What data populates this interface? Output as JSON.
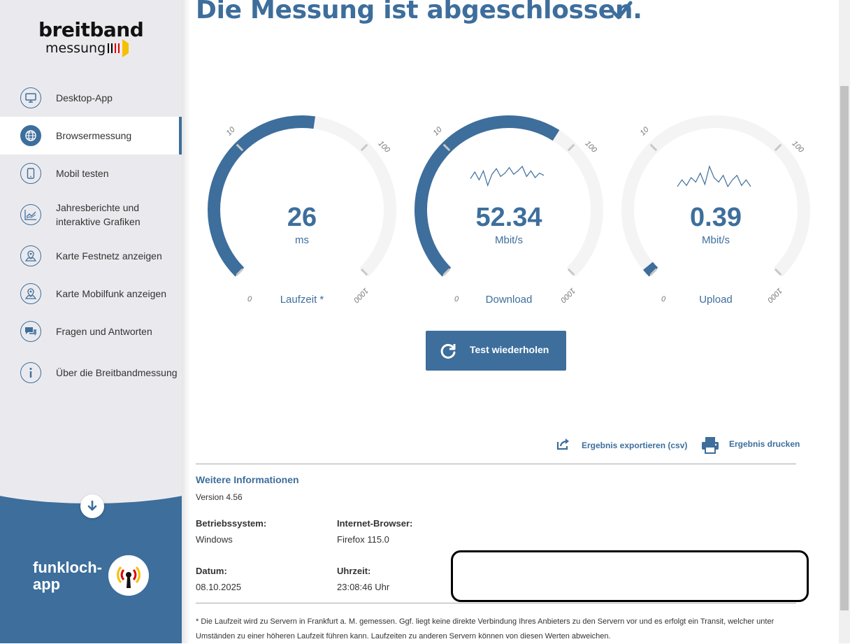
{
  "brand": {
    "line1": "breitband",
    "line2": "messung",
    "flag_colors": [
      "#000000",
      "#dd0000",
      "#ffce00"
    ]
  },
  "sidebar": {
    "items": [
      {
        "label": "Desktop-App",
        "icon": "monitor-icon",
        "active": false
      },
      {
        "label": "Browsermessung",
        "icon": "globe-icon",
        "active": true
      },
      {
        "label": "Mobil testen",
        "icon": "phone-icon",
        "active": false
      },
      {
        "label": "Jahresberichte und interaktive Grafiken",
        "icon": "chart-icon",
        "active": false
      },
      {
        "label": "Karte Festnetz anzeigen",
        "icon": "map-pin-icon",
        "active": false
      },
      {
        "label": "Karte Mobilfunk anzeigen",
        "icon": "map-pin-icon",
        "active": false
      },
      {
        "label": "Fragen und Antworten",
        "icon": "chat-icon",
        "active": false
      },
      {
        "label": "Über die Breitbandmessung",
        "icon": "info-icon",
        "active": false
      }
    ],
    "funkloch_line1": "funkloch-",
    "funkloch_line2": "app"
  },
  "headline": "Die Messung ist abgeschlossen.",
  "gauges": [
    {
      "id": "laufzeit",
      "value": "26",
      "unit": "ms",
      "label": "Laufzeit *",
      "scale": [
        "0",
        "10",
        "100",
        "1000"
      ],
      "fill_fraction": 0.53,
      "sparkline": false
    },
    {
      "id": "download",
      "value": "52.34",
      "unit": "Mbit/s",
      "label": "Download",
      "scale": [
        "0",
        "10",
        "100",
        "1000"
      ],
      "fill_fraction": 0.62,
      "sparkline": true
    },
    {
      "id": "upload",
      "value": "0.39",
      "unit": "Mbit/s",
      "label": "Upload",
      "scale": [
        "0",
        "10",
        "100",
        "1000"
      ],
      "fill_fraction": 0.02,
      "sparkline": true
    }
  ],
  "retest_label": "Test wiederholen",
  "actions": {
    "export_label": "Ergebnis exportieren (csv)",
    "print_label": "Ergebnis drucken"
  },
  "info": {
    "title": "Weitere Informationen",
    "version": "Version 4.56",
    "os_label": "Betriebssystem:",
    "os_value": "Windows",
    "browser_label": "Internet-Browser:",
    "browser_value": "Firefox 115.0",
    "date_label": "Datum:",
    "date_value": "08.10.2025",
    "time_label": "Uhrzeit:",
    "time_value": "23:08:46 Uhr"
  },
  "footnote": "* Die Laufzeit wird zu Servern in Frankfurt a. M. gemessen. Ggf. liegt keine direkte Verbindung Ihres Anbieters zu den Servern vor und es erfolgt ein Transit, welcher unter Umständen zu einer höheren Laufzeit führen kann. Laufzeiten zu anderen Servern können von diesen Werten abweichen.",
  "colors": {
    "accent": "#3d6e9c",
    "sidebar_bg": "#eaeaee",
    "track": "#f4f4f4"
  }
}
